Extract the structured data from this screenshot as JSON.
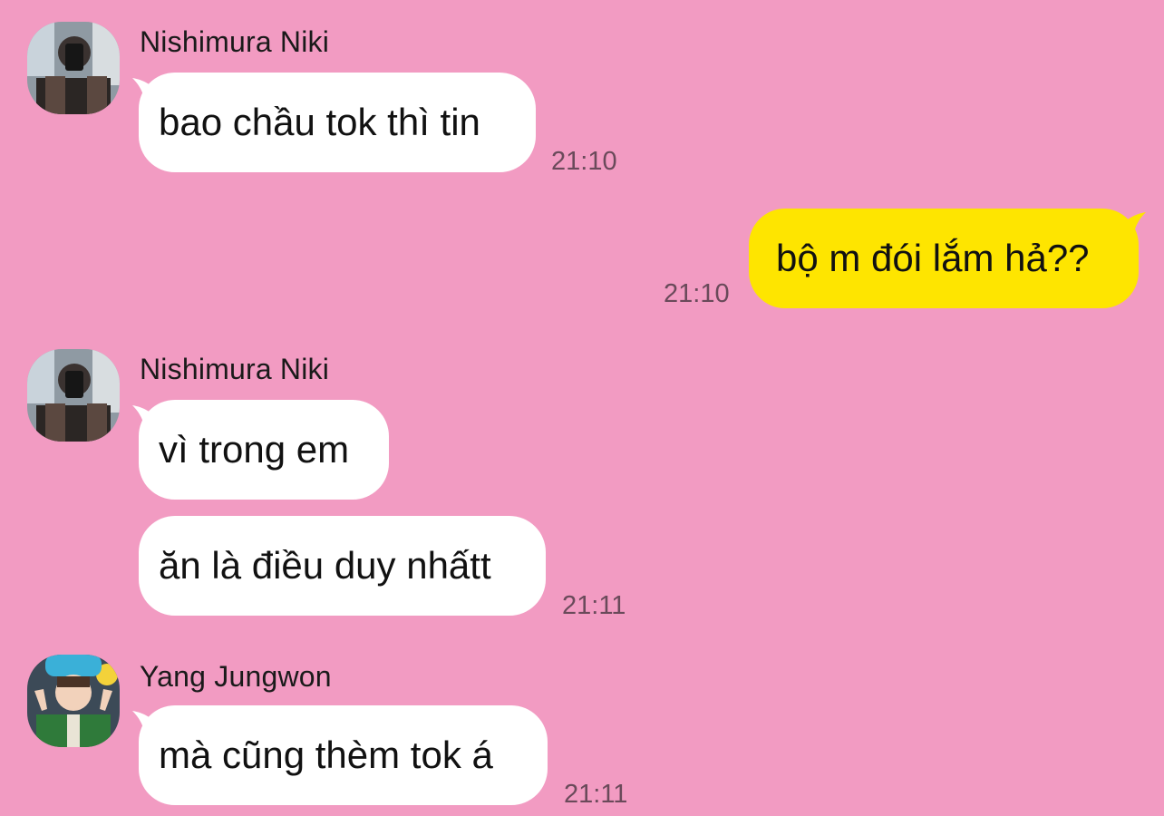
{
  "messages": [
    {
      "sender": "Nishimura Niki",
      "text": "bao chầu tok thì tin",
      "time": "21:10"
    },
    {
      "text": "bộ m đói lắm hả??",
      "time": "21:10"
    },
    {
      "sender": "Nishimura Niki",
      "text": "vì trong em"
    },
    {
      "text": "ăn là điều duy nhấtt",
      "time": "21:11"
    },
    {
      "sender": "Yang Jungwon",
      "text": "mà cũng thèm tok á",
      "time": "21:11"
    }
  ],
  "colors": {
    "background": "#F29BC2",
    "incoming_bubble": "#FFFFFF",
    "outgoing_bubble": "#FEE500",
    "timestamp": "#6A4A5A"
  }
}
